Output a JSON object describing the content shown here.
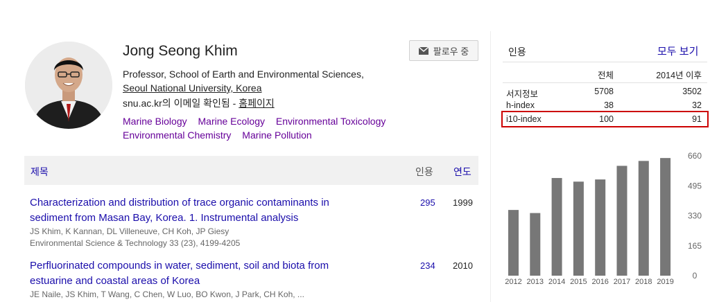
{
  "profile": {
    "name": "Jong Seong Khim",
    "follow_label": "팔로우 중",
    "affiliation_line1": "Professor, School of Earth and Environmental Sciences,",
    "affiliation_line2": "Seoul National University, Korea",
    "email_text": "snu.ac.kr의 이메일 확인됨 - ",
    "homepage_label": "홈페이지",
    "interests": [
      "Marine Biology",
      "Marine Ecology",
      "Environmental Toxicology",
      "Environmental Chemistry",
      "Marine Pollution"
    ]
  },
  "table": {
    "title_header": "제목",
    "cited_header": "인용",
    "year_header": "연도",
    "articles": [
      {
        "title": "Characterization and distribution of trace organic contaminants in sediment from Masan Bay, Korea. 1. Instrumental analysis",
        "authors": "JS Khim, K Kannan, DL Villeneuve, CH Koh, JP Giesy",
        "venue": "Environmental Science & Technology 33 (23), 4199-4205",
        "cited": "295",
        "year": "1999"
      },
      {
        "title": "Perfluorinated compounds in water, sediment, soil and biota from estuarine and coastal areas of Korea",
        "authors": "JE Naile, JS Khim, T Wang, C Chen, W Luo, BO Kwon, J Park, CH Koh, ...",
        "venue": "",
        "cited": "234",
        "year": "2010"
      }
    ]
  },
  "cited_by": {
    "title": "인용",
    "view_all": "모두 보기",
    "col_all": "전체",
    "col_since": "2014년 이후",
    "rows": [
      {
        "label": "서지정보",
        "all": "5708",
        "since": "3502"
      },
      {
        "label": "h-index",
        "all": "38",
        "since": "32"
      },
      {
        "label": "i10-index",
        "all": "100",
        "since": "91"
      }
    ]
  },
  "chart_data": {
    "type": "bar",
    "categories": [
      "2012",
      "2013",
      "2014",
      "2015",
      "2016",
      "2017",
      "2018",
      "2019"
    ],
    "values": [
      362,
      345,
      538,
      518,
      530,
      605,
      632,
      648
    ],
    "yticks": [
      "660",
      "495",
      "330",
      "165",
      "0"
    ],
    "ylim": [
      0,
      660
    ],
    "bar_color": "#777777"
  }
}
